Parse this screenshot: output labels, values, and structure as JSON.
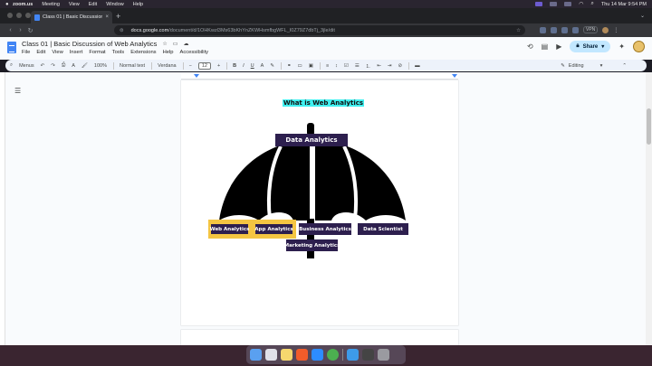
{
  "menubar": {
    "apple": "",
    "items": [
      "zoom.us",
      "Meeting",
      "View",
      "Edit",
      "Window",
      "Help"
    ],
    "clock": "Thu 14 Mar  9:54 PM",
    "vpn": "VPN"
  },
  "tab": {
    "title": "Class 01 | Basic Discussion of...",
    "close": "×"
  },
  "newtab": "+",
  "address": {
    "host": "docs.google.com",
    "path": "/document/d/1OHKwzl3Ms63bKhYnZKWHsmfbgWFL_I0Z79Z7dbTj_3jle/dit"
  },
  "docs": {
    "title": "Class 01 | Basic Discussion of Web Analytics",
    "menus": [
      "File",
      "Edit",
      "View",
      "Insert",
      "Format",
      "Tools",
      "Extensions",
      "Help",
      "Accessibility"
    ],
    "share_label": "Share"
  },
  "toolbar": {
    "search": "Menus",
    "zoom": "100%",
    "style": "Normal text",
    "font": "Verdana",
    "size": "12",
    "mode": "Editing"
  },
  "doc": {
    "heading": "What is Web Analytics",
    "data_analytics": "Data Analytics",
    "web_analytics": "Web Analytics",
    "app_analytics": "App Analytics",
    "business_analytics": "Business Analytics",
    "data_scientist": "Data Scientist",
    "marketing_analytics": "Marketing Analytics"
  },
  "colors": {
    "label_bg": "#2d1f4e",
    "highlight_cyan": "#40f0f0",
    "highlight_yellow": "#f4c542",
    "share_bg": "#c2e7ff"
  }
}
